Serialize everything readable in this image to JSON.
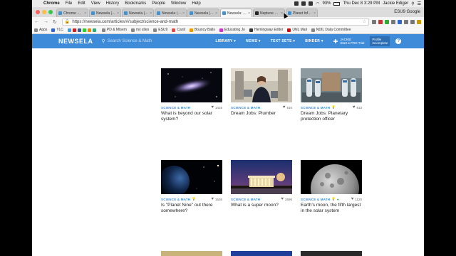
{
  "menubar": {
    "app": "Chrome",
    "items": [
      "File",
      "Edit",
      "View",
      "History",
      "Bookmarks",
      "People",
      "Window",
      "Help"
    ],
    "battery": "93%",
    "clock": "Thu Dec 8  3:29 PM",
    "user": "Jackie Ediger"
  },
  "tabs": [
    {
      "label": "Chrome Web S"
    },
    {
      "label": "Newsela | Dre"
    },
    {
      "label": "Newsela | Dre"
    },
    {
      "label": "Newsela | Adv"
    },
    {
      "label": "Newsela | Jupi"
    },
    {
      "label": "Newsela: More"
    },
    {
      "label": "Neptune Facts"
    },
    {
      "label": "Planet Info nas"
    }
  ],
  "tab_user": "ESU9 Google",
  "address": {
    "url": "https://newsela.com/articles/#/subject/science-and-math"
  },
  "bookmarks": [
    "Apps",
    "TLC",
    "PD & Mtsem",
    "my sites",
    "ESU9",
    "Canit",
    "Bouncy Balls",
    "Educating Jo",
    "Hemingway Editor",
    "UNL Mail",
    "NDIL Data Committee"
  ],
  "header": {
    "logo": "NEWSELA",
    "search_placeholder": "Search Science & Math",
    "nav": [
      "LIBRARY ▾",
      "NEWS ▾",
      "TEXT SETS ▾",
      "BINDER ▾"
    ],
    "account_name": "JACKIE",
    "account_sub": "Start a PRO Trial",
    "profile_line1": "Profile",
    "profile_line2": "Incomplete",
    "help": "?"
  },
  "articles": [
    {
      "subject": "SCIENCE & MATH",
      "count": "1416",
      "title": "What is beyond our solar system?"
    },
    {
      "subject": "SCIENCE & MATH",
      "count": "516",
      "title": "Dream Jobs: Plumber"
    },
    {
      "subject": "SCIENCE & MATH",
      "count": "613",
      "title": "Dream Jobs: Planetary protection officer"
    },
    {
      "subject": "SCIENCE & MATH",
      "count": "1636",
      "title": "Is \"Planet Nine\" out there somewhere?"
    },
    {
      "subject": "SCIENCE & MATH",
      "count": "2696",
      "title": "What is a super moon?"
    },
    {
      "subject": "SCIENCE & MATH",
      "count": "1120",
      "title": "Earth's moon, the fifth largest in the solar system"
    }
  ]
}
